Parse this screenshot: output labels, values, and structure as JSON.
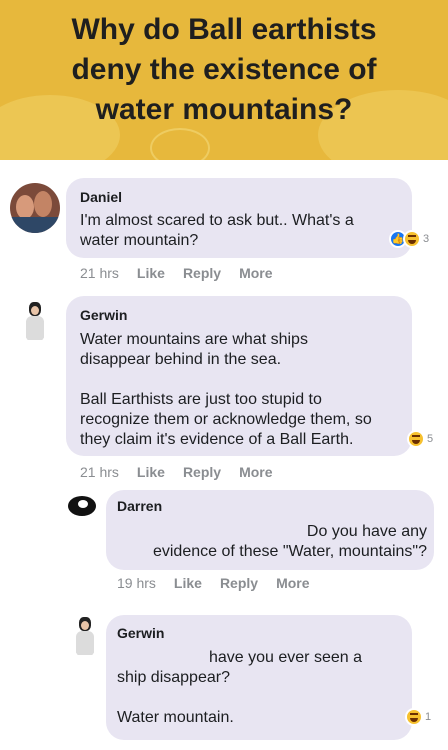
{
  "header": {
    "title": "Why do Ball earthists\ndeny the existence of\nwater mountains?"
  },
  "comments": [
    {
      "name": "Daniel",
      "text": "I'm almost scared to ask but.. What's a\nwater mountain?",
      "time": "21 hrs",
      "actions": [
        "Like",
        "Reply",
        "More"
      ],
      "reactions": {
        "icons": [
          "like-icon",
          "haha-icon"
        ],
        "count": "3"
      }
    },
    {
      "name": "Gerwin",
      "text": "Water mountains are what ships\ndisappear behind in the sea.\n\nBall Earthists are just too stupid to\nrecognize them or acknowledge them, so\nthey claim it's evidence of a Ball Earth.",
      "time": "21 hrs",
      "actions": [
        "Like",
        "Reply",
        "More"
      ],
      "reactions": {
        "icons": [
          "haha-icon"
        ],
        "count": "5"
      }
    },
    {
      "name": "Darren",
      "text": "Do you have any\nevidence of these \"Water, mountains\"?",
      "time": "19 hrs",
      "actions": [
        "Like",
        "Reply",
        "More"
      ]
    },
    {
      "name": "Gerwin",
      "text": "have you ever seen a\nship disappear?\n\nWater mountain.",
      "reactions": {
        "icons": [
          "haha-icon"
        ],
        "count": "1"
      }
    }
  ],
  "colors": {
    "header_bg": "#e7b83c",
    "bubble_bg": "#e8e5f2",
    "meta_text": "#8a8d91"
  }
}
